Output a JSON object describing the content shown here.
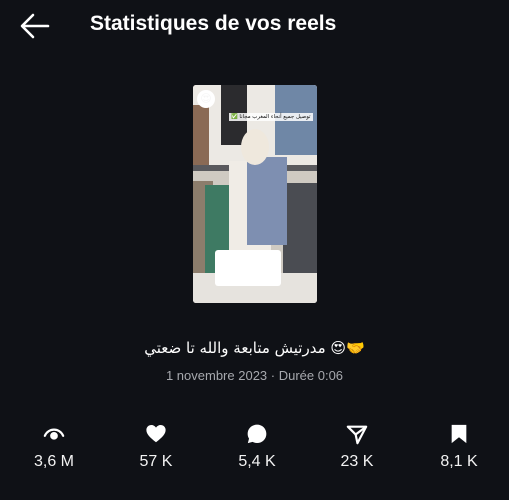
{
  "header": {
    "back_icon": "arrow-left-icon",
    "title": "Statistiques de vos reels"
  },
  "reel": {
    "thumbnail_banner": "توصيل جميع أنحاء المغرب مجانا ✅",
    "thumbnail_badge": "😍",
    "caption": "مدرتيش متابعة والله تا ضعتي 😍🤝",
    "meta": "1 novembre 2023 · Durée 0:06"
  },
  "stats": [
    {
      "icon": "eye-icon",
      "value": "3,6 M"
    },
    {
      "icon": "heart-icon",
      "value": "57 K"
    },
    {
      "icon": "comment-icon",
      "value": "5,4 K"
    },
    {
      "icon": "share-icon",
      "value": "23 K"
    },
    {
      "icon": "bookmark-icon",
      "value": "8,1 K"
    }
  ],
  "colors": {
    "background": "#0f1116",
    "text": "#ffffff",
    "muted": "#a6a8ad"
  }
}
